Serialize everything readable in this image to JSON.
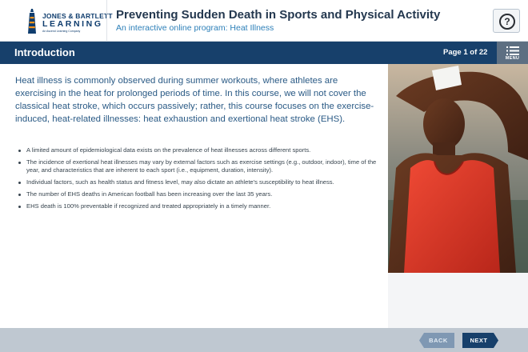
{
  "brand": {
    "line1": "JONES & BARTLETT",
    "line2": "LEARNING",
    "line3": "An Ascend Learning Company",
    "colors": {
      "navy": "#17406b",
      "orange": "#f7941d"
    }
  },
  "header": {
    "course_title": "Preventing Sudden Death in Sports and Physical Activity",
    "course_subtitle": "An interactive online program: Heat Illness",
    "help_label": "?",
    "help_icon": "question-circle-icon"
  },
  "titlebar": {
    "section_title": "Introduction",
    "page_indicator": "Page 1 of 22",
    "menu_label": "MENU",
    "menu_icon": "list-menu-icon"
  },
  "main": {
    "intro": "Heat illness is commonly observed during summer workouts, where athletes are exercising in the heat for prolonged periods of time. In this course, we will not cover the classical heat stroke, which occurs passively; rather, this course focuses on the exercise-induced, heat-related illnesses: heat exhaustion and exertional heat stroke (EHS).",
    "bullets": [
      "A limited amount of epidemiological data exists on the prevalence of heat illnesses across different sports.",
      "The incidence of exertional heat illnesses may vary by external factors such as exercise settings (e.g., outdoor, indoor), time of the year, and characteristics that are inherent to each sport (i.e., equipment, duration, intensity).",
      "Individual factors, such as health status and fitness level, may also dictate an athlete's susceptibility to heat illness.",
      "The number of EHS deaths in American football has been increasing over the last 35 years.",
      "EHS death is 100% preventable if recognized and treated appropriately in a timely manner."
    ]
  },
  "footer": {
    "back_label": "BACK",
    "next_label": "NEXT"
  }
}
